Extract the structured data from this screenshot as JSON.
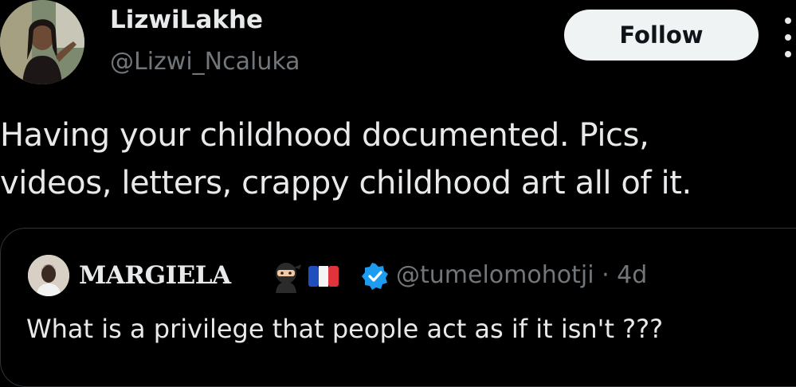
{
  "author": {
    "display_name": "LizwiLakhe",
    "handle": "@Lizwi_Ncaluka",
    "avatar": "profile-photo"
  },
  "follow_button": {
    "label": "Follow"
  },
  "more_menu": {
    "icon": "more-vertical-icon"
  },
  "tweet": {
    "lines": [
      "Having your childhood documented. Pics,",
      "videos, letters, crappy childhood art all of it."
    ]
  },
  "quoted": {
    "display_name": "MARGIELA",
    "emojis": [
      "ninja-emoji",
      "flag-france-emoji"
    ],
    "verified_icon": "verified-badge-icon",
    "handle": "@tumelomohotji",
    "time": "· 4d",
    "text": "What is a privilege that people act as if it isn't ???"
  },
  "colors": {
    "background": "#000000",
    "text": "#e7e9ea",
    "secondary_text": "#71767b",
    "verified": "#1d9bf0",
    "follow_bg": "#eff3f4"
  }
}
